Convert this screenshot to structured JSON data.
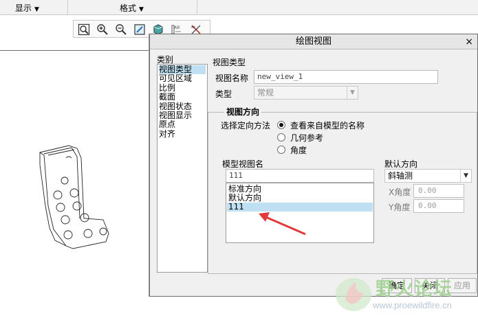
{
  "menubar": {
    "display_label": "显示",
    "format_label": "格式"
  },
  "dialog": {
    "title": "绘图视图",
    "close_glyph": "×",
    "category_heading": "类别",
    "categories": [
      "视图类型",
      "可见区域",
      "比例",
      "截面",
      "视图状态",
      "视图显示",
      "原点",
      "对齐"
    ],
    "section_title": "视图类型",
    "view_name_label": "视图名称",
    "view_name_value": "new_view_1",
    "type_label": "类型",
    "type_value": "常规",
    "orientation_title": "视图方向",
    "method_label": "选择定向方法",
    "radio_options": [
      "查看来自模型的名称",
      "几何参考",
      "角度"
    ],
    "model_view_label": "模型视图名",
    "model_view_value": "111",
    "model_views": [
      "标准方向",
      "默认方向",
      "111"
    ],
    "default_dir_label": "默认方向",
    "default_dir_value": "斜轴测",
    "x_angle_label": "X角度",
    "x_angle_value": "0.00",
    "y_angle_label": "Y角度",
    "y_angle_value": "0.00",
    "buttons": {
      "ok": "确定",
      "close": "关闭",
      "apply": "应用"
    }
  },
  "watermark": {
    "text": "野火论坛",
    "url": "www.proewildfire.cn"
  }
}
